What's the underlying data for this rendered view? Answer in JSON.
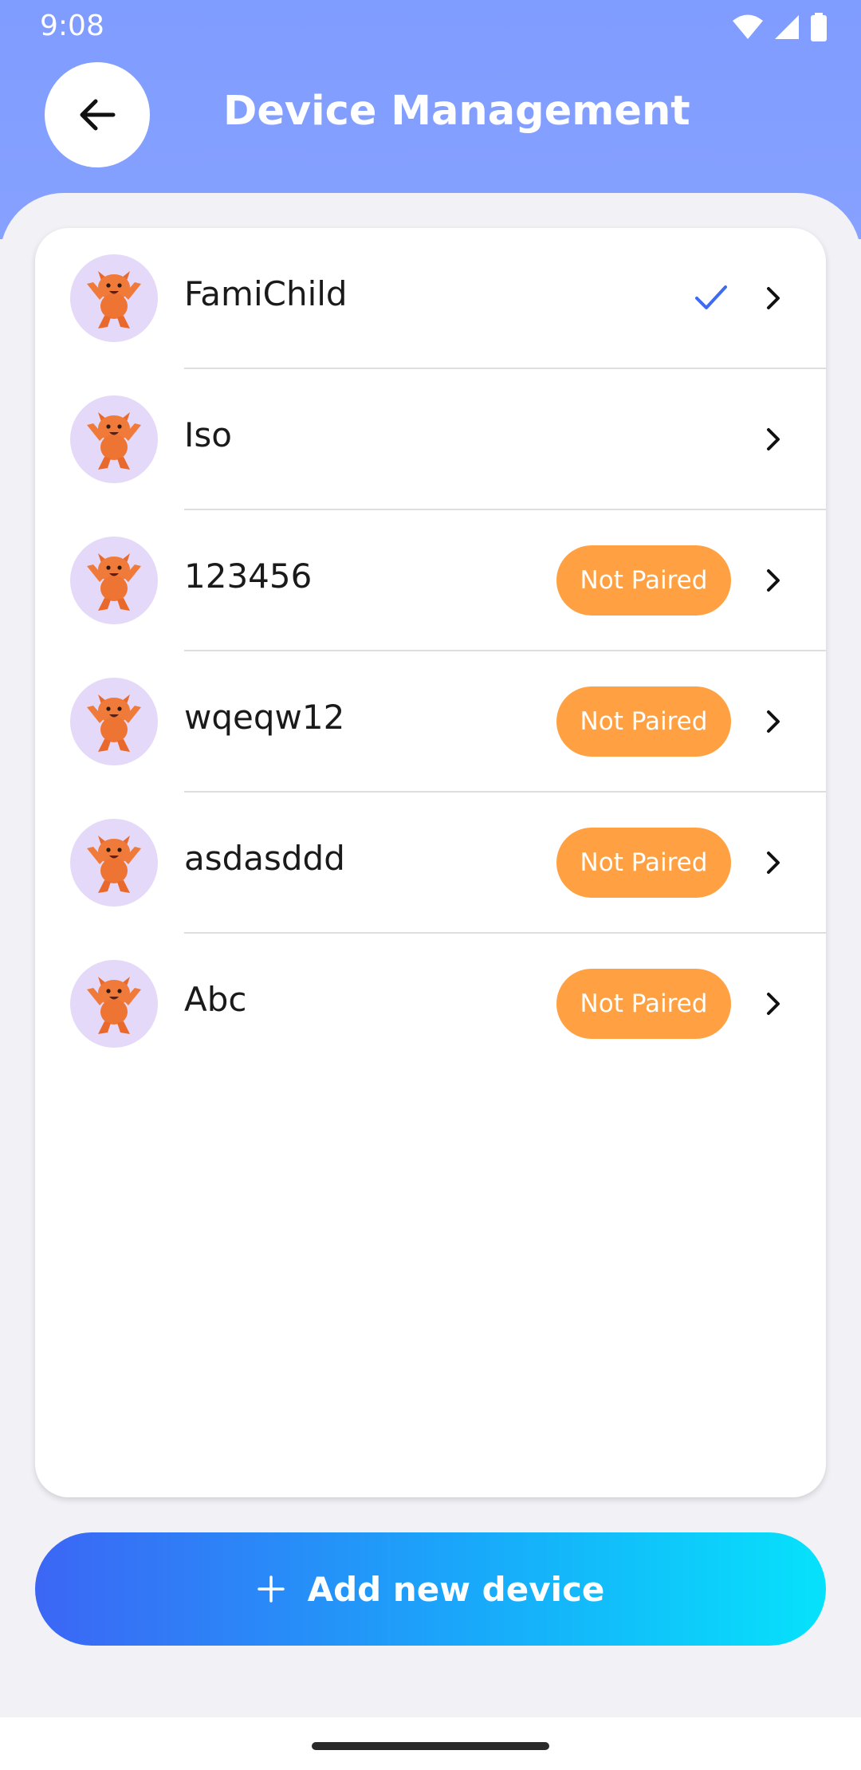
{
  "status_bar": {
    "time": "9:08"
  },
  "header": {
    "title": "Device Management",
    "back_icon": "arrow-left-icon"
  },
  "devices": [
    {
      "name": "FamiChild",
      "status": "selected",
      "badge": ""
    },
    {
      "name": "Iso",
      "status": "paired",
      "badge": ""
    },
    {
      "name": "123456",
      "status": "not-paired",
      "badge": "Not Paired"
    },
    {
      "name": "wqeqw12",
      "status": "not-paired",
      "badge": "Not Paired"
    },
    {
      "name": "asdasddd",
      "status": "not-paired",
      "badge": "Not Paired"
    },
    {
      "name": "Abc",
      "status": "not-paired",
      "badge": "Not Paired"
    }
  ],
  "add_button": {
    "label": "Add new device",
    "icon": "plus-icon"
  },
  "colors": {
    "header": "#7f9cff",
    "badge": "#ffa142",
    "check": "#3f6bef",
    "button_start": "#3c66f5",
    "button_end": "#06e2fb"
  }
}
